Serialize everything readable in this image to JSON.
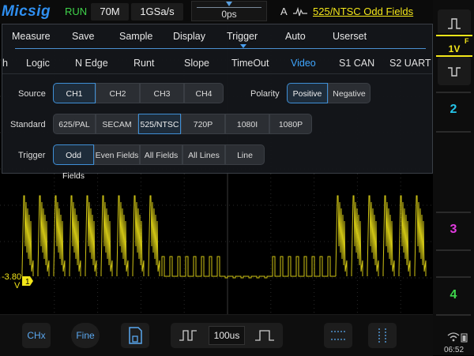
{
  "topbar": {
    "brand": "Micsig",
    "status": "RUN",
    "memory_depth": "70M",
    "sample_rate": "1GSa/s",
    "trigger_position": "0ps",
    "trigger_channel": "A",
    "trigger_icon": "video-trigger-icon",
    "trigger_summary": "525/NTSC Odd Fields"
  },
  "menu": {
    "tabs": [
      {
        "label": "Measure"
      },
      {
        "label": "Save"
      },
      {
        "label": "Sample"
      },
      {
        "label": "Display"
      },
      {
        "label": "Trigger"
      },
      {
        "label": "Auto"
      },
      {
        "label": "Userset"
      }
    ],
    "active_tab": "Trigger",
    "subtabs": [
      {
        "label": "h"
      },
      {
        "label": "Logic"
      },
      {
        "label": "N Edge"
      },
      {
        "label": "Runt"
      },
      {
        "label": "Slope"
      },
      {
        "label": "TimeOut"
      },
      {
        "label": "Video"
      },
      {
        "label": "S1 CAN"
      },
      {
        "label": "S2 UART"
      }
    ],
    "active_subtab": "Video",
    "source": {
      "label": "Source",
      "options": [
        "CH1",
        "CH2",
        "CH3",
        "CH4"
      ],
      "selected": "CH1"
    },
    "polarity": {
      "label": "Polarity",
      "options": [
        "Positive",
        "Negative"
      ],
      "selected": "Positive"
    },
    "standard": {
      "label": "Standard",
      "options": [
        "625/PAL",
        "SECAM",
        "525/NTSC",
        "720P",
        "1080I",
        "1080P"
      ],
      "selected": "525/NTSC"
    },
    "trigger": {
      "label": "Trigger",
      "options": [
        "Odd Fields",
        "Even Fields",
        "All Fields",
        "All Lines",
        "Line"
      ],
      "selected": "Odd Fields"
    }
  },
  "channel": {
    "offset_label": "-3.80",
    "offset_unit": "V",
    "marker": "1",
    "color": "#f3e619"
  },
  "sidebar": {
    "ch1_scale": "1V",
    "ch1_flag": "F",
    "ch2": "2",
    "ch3": "3",
    "ch4": "4",
    "ch2_color": "#25c4e8",
    "ch3_color": "#e23be0",
    "ch4_color": "#3ed64c"
  },
  "bottombar": {
    "chx": "CHx",
    "fine": "Fine",
    "timebase": "100us"
  },
  "status": {
    "time": "06:52"
  }
}
